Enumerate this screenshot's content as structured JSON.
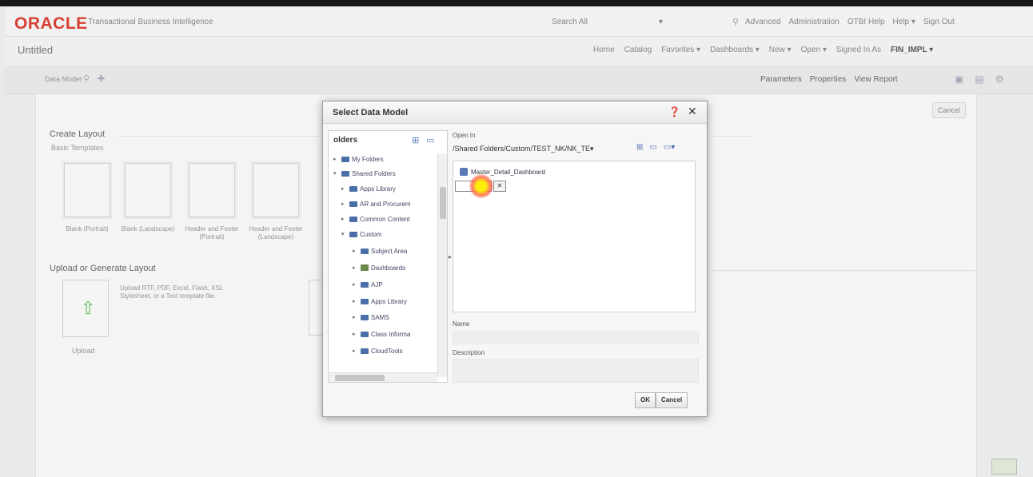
{
  "app": {
    "logo": "ORACLE",
    "product": "Transactional Business Intelligence",
    "search_scope": "Search  All",
    "top_links": [
      "Advanced",
      "Administration",
      "OTBI Help",
      "Help ▾",
      "Sign Out"
    ]
  },
  "page": {
    "title": "Untitled",
    "nav": [
      "Home",
      "Catalog",
      "Favorites ▾",
      "Dashboards ▾",
      "New ▾",
      "Open ▾",
      "Signed In As"
    ],
    "signed_in_user": "FIN_IMPL ▾"
  },
  "toolbar": {
    "data_model_label": "Data Model",
    "right_links": [
      "Parameters",
      "Properties",
      "View Report"
    ]
  },
  "canvas": {
    "cancel_label": "Cancel",
    "create_layout_title": "Create Layout",
    "basic_templates_label": "Basic Templates",
    "templates": [
      {
        "label": "Blank (Portrait)"
      },
      {
        "label": "Blank (Landscape)"
      },
      {
        "label": "Header and Footer (Portrait)"
      },
      {
        "label": "Header and Footer (Landscape)"
      }
    ],
    "upload_title": "Upload or Generate Layout",
    "upload_desc": "Upload RTF, PDF, Excel, Flash, XSL Stylesheet, or a Text template file.",
    "upload_label": "Upload"
  },
  "dialog": {
    "title": "Select Data Model",
    "folders_label": "olders",
    "tree": [
      {
        "label": "My Folders",
        "depth": 0,
        "toggle": "▸",
        "kind": "folder"
      },
      {
        "label": "Shared Folders",
        "depth": 0,
        "toggle": "▾",
        "kind": "folder"
      },
      {
        "label": "Apps Library",
        "depth": 1,
        "toggle": "▸",
        "kind": "folder"
      },
      {
        "label": "AR and Procurem",
        "depth": 1,
        "toggle": "▸",
        "kind": "folder"
      },
      {
        "label": "Common Content",
        "depth": 1,
        "toggle": "▸",
        "kind": "folder"
      },
      {
        "label": "Custom",
        "depth": 1,
        "toggle": "▾",
        "kind": "folder"
      },
      {
        "label": "Subject Area",
        "depth": 2,
        "toggle": "▸",
        "kind": "folder"
      },
      {
        "label": "Dashboards",
        "depth": 2,
        "toggle": "▸",
        "kind": "dashboard"
      },
      {
        "label": "AJP",
        "depth": 2,
        "toggle": "▸",
        "kind": "folder"
      },
      {
        "label": "Apps Library",
        "depth": 2,
        "toggle": "▸",
        "kind": "folder"
      },
      {
        "label": "SAMS",
        "depth": 2,
        "toggle": "▸",
        "kind": "folder"
      },
      {
        "label": "Class Informa",
        "depth": 2,
        "toggle": "▸",
        "kind": "folder"
      },
      {
        "label": "CloudTools",
        "depth": 2,
        "toggle": "▸",
        "kind": "folder"
      }
    ],
    "open_in_label": "Open In",
    "path": "/Shared Folders/Custom/TEST_NK/NK_TE▾",
    "data_model_item": "Master_Detail_Dashboard",
    "rename_ok": "✓",
    "rename_cancel": "✕",
    "name_label": "Name",
    "name_value": "",
    "description_label": "Description",
    "description_value": "",
    "ok_label": "OK",
    "cancel_label": "Cancel"
  },
  "colors": {
    "oracle_red": "#e03a2e",
    "folder_blue": "#4a6fa8"
  }
}
